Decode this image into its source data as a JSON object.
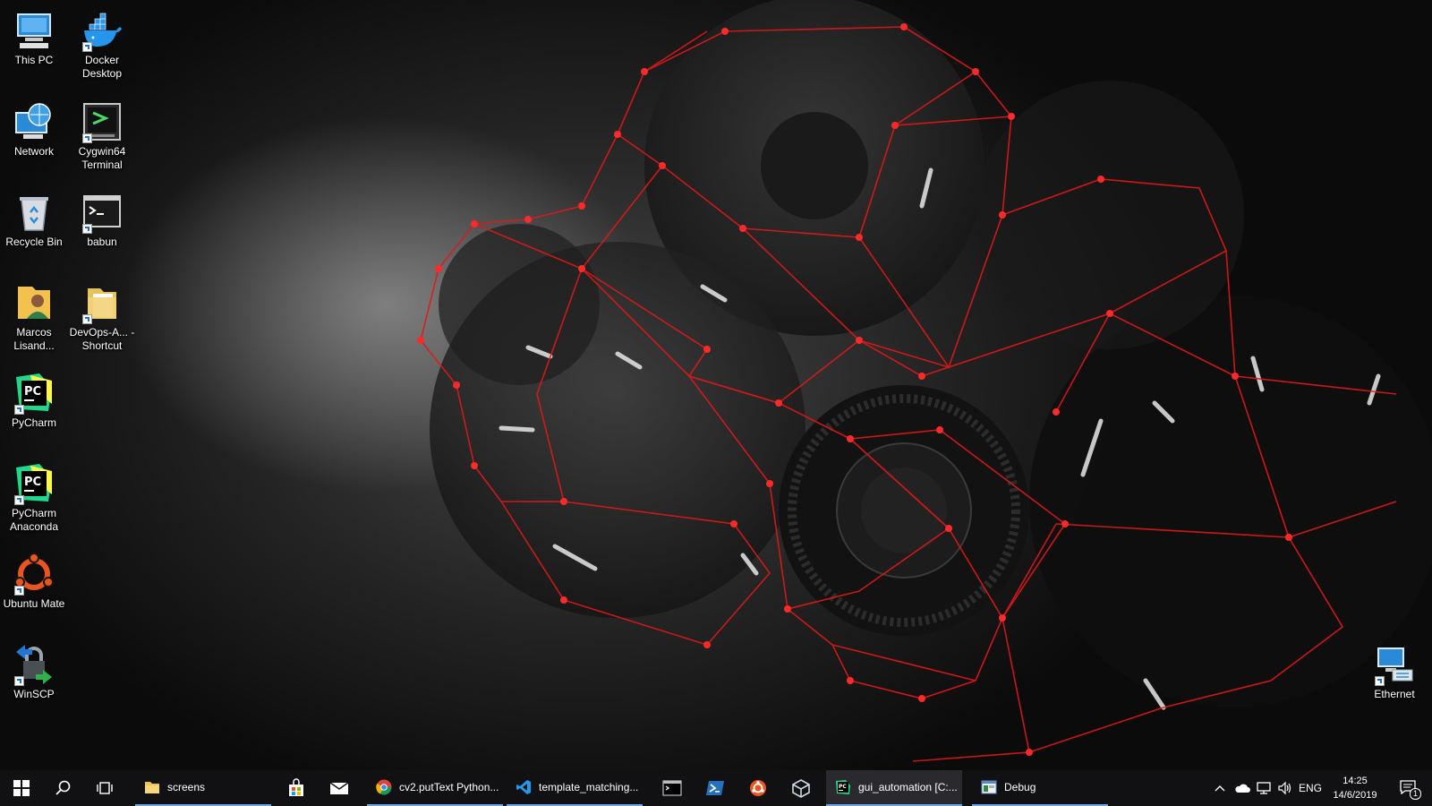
{
  "desktop": {
    "icons": [
      {
        "label": "This PC"
      },
      {
        "label": "Docker Desktop"
      },
      {
        "label": "Network"
      },
      {
        "label": "Cygwin64 Terminal"
      },
      {
        "label": "Recycle Bin"
      },
      {
        "label": "babun"
      },
      {
        "label": "Marcos Lisand..."
      },
      {
        "label": "DevOps-A... - Shortcut"
      },
      {
        "label": "PyCharm"
      },
      {
        "label": "PyCharm Anaconda"
      },
      {
        "label": "Ubuntu Mate"
      },
      {
        "label": "WinSCP"
      },
      {
        "label": "Ethernet"
      }
    ]
  },
  "taskbar": {
    "start_icon": "windows-logo-icon",
    "search_icon": "search-icon",
    "task_view_icon": "task-view-icon",
    "apps": [
      {
        "label": "screens",
        "icon": "folder-icon"
      },
      {
        "label": "cv2.putText Python...",
        "icon": "chrome-icon"
      },
      {
        "label": "template_matching...",
        "icon": "vscode-icon"
      },
      {
        "label": "gui_automation [C:...",
        "icon": "pycharm-icon"
      },
      {
        "label": "Debug",
        "icon": "window-icon"
      }
    ],
    "pinned": [
      "store-icon",
      "mail-icon",
      "terminal-icon",
      "powershell-icon",
      "ubuntu-icon",
      "virtualbox-icon"
    ],
    "tray": {
      "language": "ENG",
      "time": "14:25",
      "date": "14/6/2019",
      "notification_count": "1"
    }
  },
  "colors": {
    "taskbar_bg": "#111113",
    "accent_underline": "#6aa7e8",
    "wallpaper_red": "#e01818"
  }
}
